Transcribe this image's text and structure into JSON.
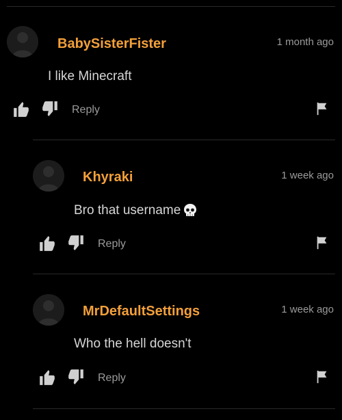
{
  "comments": [
    {
      "username": "BabySisterFister",
      "time": "1 month ago",
      "text": "I like Minecraft",
      "emoji": "",
      "reply_label": "Reply"
    },
    {
      "username": "Khyraki",
      "time": "1 week ago",
      "text": "Bro that username",
      "emoji": "skull-emoji",
      "reply_label": "Reply"
    },
    {
      "username": "MrDefaultSettings",
      "time": "1 week ago",
      "text": "Who the hell doesn't",
      "emoji": "",
      "reply_label": "Reply"
    }
  ],
  "colors": {
    "background": "#000000",
    "username": "#f3a03a",
    "muted": "#9b9b9b",
    "text": "#d6d6d6",
    "icon": "#d0d0d0"
  }
}
